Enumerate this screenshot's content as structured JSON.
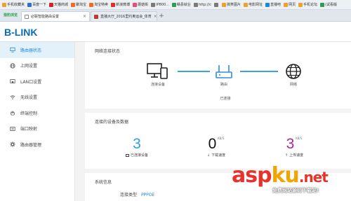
{
  "browser": {
    "bookmarks": [
      {
        "label": "手机收藏夹",
        "color": "#f0a030"
      },
      {
        "label": "百度一下",
        "color": "#2d6ed8"
      },
      {
        "label": "天猫商城",
        "color": "#d2232a"
      },
      {
        "label": "聚淘宝",
        "color": "#f36c21"
      },
      {
        "label": "淘宝特卖",
        "color": "#f36c21"
      },
      {
        "label": "新浪微博",
        "color": "#e02f26"
      },
      {
        "label": "蘑菇街",
        "color": "#e94b7b"
      },
      {
        "label": "IP800...",
        "color": "#7a7a7a"
      },
      {
        "label": "赣县就业",
        "color": "#2a9d5b"
      },
      {
        "label": "http://c",
        "color": "#7a7a7a"
      },
      {
        "label": "",
        "color": "#7a7a7a"
      },
      {
        "label": "搞笑图片",
        "color": "#f0a030"
      },
      {
        "label": "电影网址",
        "color": "#f0a030"
      },
      {
        "label": "直播吧",
        "color": "#1a8ad6"
      },
      {
        "label": "网页",
        "color": "#f0a030"
      },
      {
        "label": "手机论坛",
        "color": "#f0a030"
      },
      {
        "label": "(试看版",
        "color": "#2a9d5b"
      }
    ],
    "brand_label": "猎豹浏览",
    "tabs": [
      {
        "label": "必联智能路由设置",
        "close": "×"
      },
      {
        "label": "直播大厅_2016里约奥运会_体育",
        "close": "×"
      }
    ],
    "new_tab": "+"
  },
  "router": {
    "logo": "B-LINK"
  },
  "sidebar": {
    "items": [
      {
        "label": "路由器状态",
        "icon": "monitor-icon",
        "active": true
      },
      {
        "label": "上网设置",
        "icon": "globe-icon",
        "active": false
      },
      {
        "label": "LAN口设置",
        "icon": "lan-port-icon",
        "active": false
      },
      {
        "label": "无线设置",
        "icon": "wifi-icon",
        "active": false
      },
      {
        "label": "终端控制",
        "icon": "hand-icon",
        "active": false
      },
      {
        "label": "端口映射",
        "icon": "port-map-icon",
        "active": false
      },
      {
        "label": "路由器管理",
        "icon": "gear-icon",
        "active": false
      }
    ]
  },
  "network_status": {
    "title": "网络连接状态",
    "nodes": {
      "device": "连接设备",
      "router": "路由",
      "internet": "网络"
    },
    "status": "已连接"
  },
  "devices": {
    "title": "连接的设备及数据",
    "connected": {
      "value": "3",
      "label": "已连接设备"
    },
    "download": {
      "value": "0",
      "unit": "KB/S",
      "label": "下载速度"
    },
    "upload": {
      "value": "3",
      "unit": "KB/S",
      "label": "上传速度"
    },
    "colors": {
      "connected": "#2aa0e8",
      "download": "#111111",
      "upload": "#a42c8f"
    }
  },
  "system_info": {
    "title": "系统信息",
    "connection_type_label": "连接类型",
    "connection_type_value": "PPPOE"
  },
  "watermark": {
    "text_asp": "asp",
    "text_ku": "ku",
    "text_net": ".net",
    "subtitle": "免费网站源码下载站!"
  }
}
